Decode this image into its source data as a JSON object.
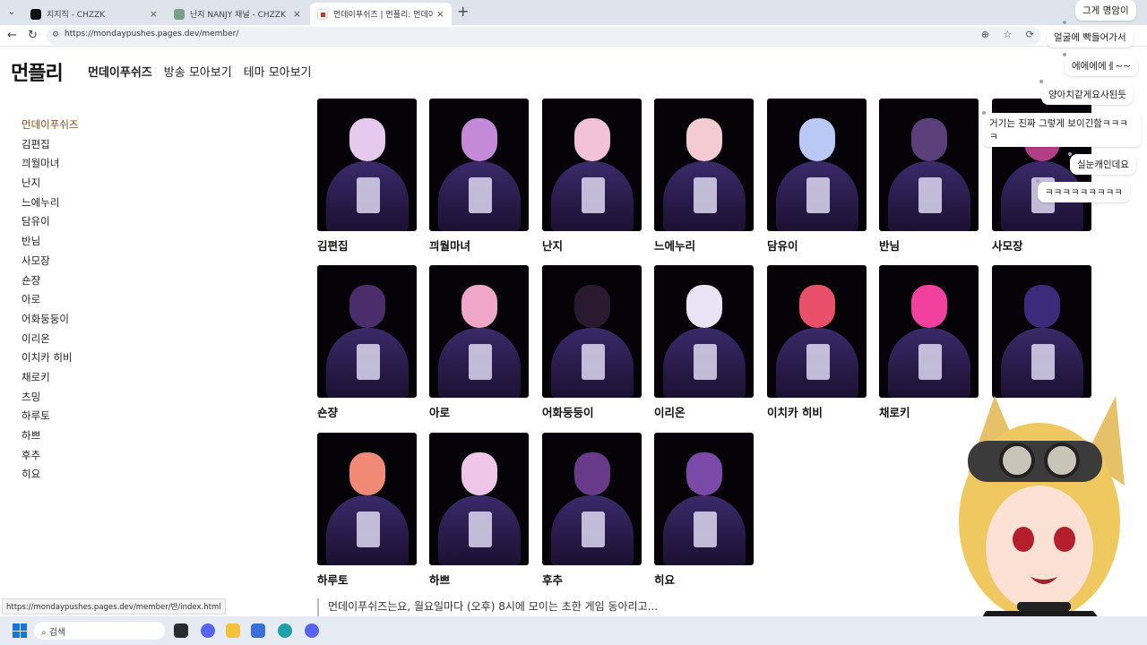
{
  "browser": {
    "tabs": [
      {
        "title": "치지직 - CHZZK",
        "favicon_color": "#111111"
      },
      {
        "title": "난지 NANJY 채널 - CHZZK",
        "favicon_color": "#7aa08a"
      },
      {
        "title": "먼데이푸쉬즈 | 먼플리: 먼데이푸쉬",
        "favicon_color": "#c0392b"
      }
    ],
    "new_tab_glyph": "+",
    "url": "https://mondaypushes.pages.dev/member/"
  },
  "site": {
    "logo": "먼플리",
    "nav": [
      "먼데이푸쉬즈",
      "방송 모아보기",
      "테마 모아보기"
    ]
  },
  "sidebar": [
    "먼데이푸쉬즈",
    "김편집",
    "끠월마녀",
    "난지",
    "느에누리",
    "담유이",
    "반님",
    "사모장",
    "숀쟝",
    "아로",
    "어화둥둥이",
    "이리온",
    "이치카 히비",
    "채로키",
    "츠밍",
    "하루토",
    "하쁘",
    "후추",
    "히요"
  ],
  "members": [
    {
      "name": "김편집",
      "hair": "#e7c9ee"
    },
    {
      "name": "끠월마녀",
      "hair": "#c489d8"
    },
    {
      "name": "난지",
      "hair": "#f1c2d8"
    },
    {
      "name": "느에누리",
      "hair": "#f2cbd3"
    },
    {
      "name": "담유이",
      "hair": "#b9c8f5"
    },
    {
      "name": "반님",
      "hair": "#5b3f7a"
    },
    {
      "name": "사모장",
      "hair": "#b23f86"
    },
    {
      "name": "숀쟝",
      "hair": "#4a2d6a"
    },
    {
      "name": "아로",
      "hair": "#f0a6c8"
    },
    {
      "name": "어화둥둥이",
      "hair": "#2a1a30"
    },
    {
      "name": "이리온",
      "hair": "#eae3f6"
    },
    {
      "name": "이치카 히비",
      "hair": "#e8506a"
    },
    {
      "name": "채로키",
      "hair": "#f1409d"
    },
    {
      "name": "",
      "hair": "#3a2c7a"
    },
    {
      "name": "하루토",
      "hair": "#f08a76"
    },
    {
      "name": "하쁘",
      "hair": "#f0c6e8"
    },
    {
      "name": "후추",
      "hair": "#6a3a8a"
    },
    {
      "name": "히요",
      "hair": "#7b4aa8"
    }
  ],
  "intro_text": "먼데이푸쉬즈는요, 월요일마다 (오후) 8시에 모이는 초한 게임 동아리고...",
  "status_url": "https://mondaypushes.pages.dev/member/반/index.html",
  "taskbar": {
    "search_placeholder": "검색"
  },
  "chat": [
    "그게 명암이",
    "얼굴에 빡들어가서",
    "에에에에ㅔ~~",
    "양아치같게요사된듯",
    "거기는 진짜 그렇게 보이긴함ㅋㅋㅋㅋ",
    "실눈캐인데요",
    "ㅋㅋㅋㅋㅋㅋㅋㅋㅋ"
  ]
}
